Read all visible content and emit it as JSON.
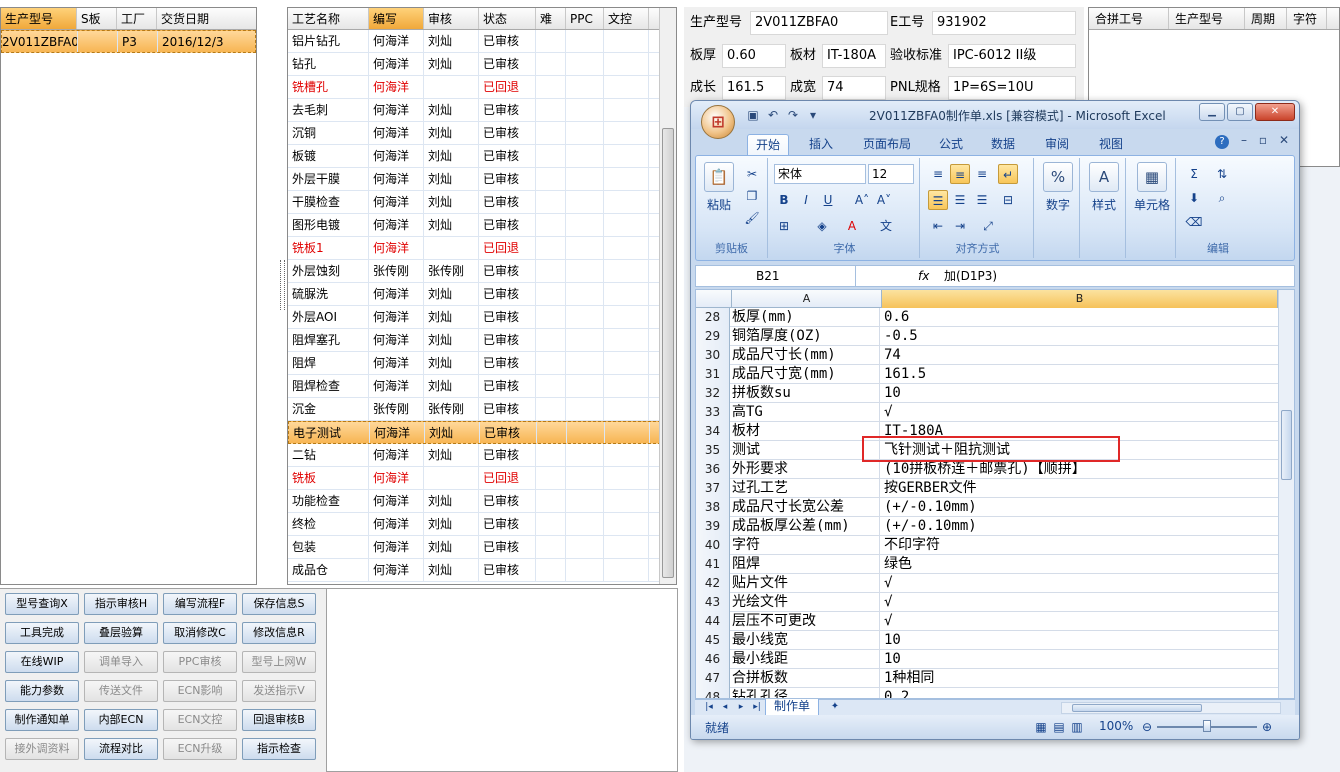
{
  "order_grid": {
    "columns": [
      "生产型号",
      "S板",
      "工厂",
      "交货日期"
    ],
    "rows": [
      {
        "model": "2V011ZBFA0",
        "s_board": "",
        "factory": "P3",
        "date": "2016/12/3"
      }
    ]
  },
  "process_grid": {
    "columns": [
      "工艺名称",
      "编写",
      "审核",
      "状态",
      "难",
      "PPC",
      "文控"
    ],
    "rows": [
      {
        "name": "铝片钻孔",
        "writer": "何海洋",
        "auditor": "刘灿",
        "status": "已审核",
        "red": false
      },
      {
        "name": "钻孔",
        "writer": "何海洋",
        "auditor": "刘灿",
        "status": "已审核",
        "red": false
      },
      {
        "name": "铣槽孔",
        "writer": "何海洋",
        "auditor": "",
        "status": "已回退",
        "red": true
      },
      {
        "name": "去毛刺",
        "writer": "何海洋",
        "auditor": "刘灿",
        "status": "已审核",
        "red": false
      },
      {
        "name": "沉铜",
        "writer": "何海洋",
        "auditor": "刘灿",
        "status": "已审核",
        "red": false
      },
      {
        "name": "板镀",
        "writer": "何海洋",
        "auditor": "刘灿",
        "status": "已审核",
        "red": false
      },
      {
        "name": "外层干膜",
        "writer": "何海洋",
        "auditor": "刘灿",
        "status": "已审核",
        "red": false
      },
      {
        "name": "干膜检查",
        "writer": "何海洋",
        "auditor": "刘灿",
        "status": "已审核",
        "red": false
      },
      {
        "name": "图形电镀",
        "writer": "何海洋",
        "auditor": "刘灿",
        "status": "已审核",
        "red": false
      },
      {
        "name": "铣板1",
        "writer": "何海洋",
        "auditor": "",
        "status": "已回退",
        "red": true
      },
      {
        "name": "外层蚀刻",
        "writer": "张传刚",
        "auditor": "张传刚",
        "status": "已审核",
        "red": false
      },
      {
        "name": "硫脲洗",
        "writer": "何海洋",
        "auditor": "刘灿",
        "status": "已审核",
        "red": false
      },
      {
        "name": "外层AOI",
        "writer": "何海洋",
        "auditor": "刘灿",
        "status": "已审核",
        "red": false
      },
      {
        "name": "阻焊塞孔",
        "writer": "何海洋",
        "auditor": "刘灿",
        "status": "已审核",
        "red": false
      },
      {
        "name": "阻焊",
        "writer": "何海洋",
        "auditor": "刘灿",
        "status": "已审核",
        "red": false
      },
      {
        "name": "阻焊检查",
        "writer": "何海洋",
        "auditor": "刘灿",
        "status": "已审核",
        "red": false
      },
      {
        "name": "沉金",
        "writer": "张传刚",
        "auditor": "张传刚",
        "status": "已审核",
        "red": false
      },
      {
        "name": "电子测试",
        "writer": "何海洋",
        "auditor": "刘灿",
        "status": "已审核",
        "red": false,
        "selected": true
      },
      {
        "name": "二钻",
        "writer": "何海洋",
        "auditor": "刘灿",
        "status": "已审核",
        "red": false
      },
      {
        "name": "铣板",
        "writer": "何海洋",
        "auditor": "",
        "status": "已回退",
        "red": true
      },
      {
        "name": "功能检查",
        "writer": "何海洋",
        "auditor": "刘灿",
        "status": "已审核",
        "red": false
      },
      {
        "name": "终检",
        "writer": "何海洋",
        "auditor": "刘灿",
        "status": "已审核",
        "red": false
      },
      {
        "name": "包装",
        "writer": "何海洋",
        "auditor": "刘灿",
        "status": "已审核",
        "red": false
      },
      {
        "name": "成品仓",
        "writer": "何海洋",
        "auditor": "刘灿",
        "status": "已审核",
        "red": false
      }
    ]
  },
  "buttons": [
    [
      {
        "label": "型号查询X",
        "disabled": false
      },
      {
        "label": "指示审核H",
        "disabled": false
      },
      {
        "label": "编写流程F",
        "disabled": false
      },
      {
        "label": "保存信息S",
        "disabled": false
      }
    ],
    [
      {
        "label": "工具完成",
        "disabled": false
      },
      {
        "label": "叠层验算",
        "disabled": false
      },
      {
        "label": "取消修改C",
        "disabled": false
      },
      {
        "label": "修改信息R",
        "disabled": false
      }
    ],
    [
      {
        "label": "在线WIP",
        "disabled": false
      },
      {
        "label": "调单导入",
        "disabled": true
      },
      {
        "label": "PPC审核",
        "disabled": true
      },
      {
        "label": "型号上网W",
        "disabled": true
      }
    ],
    [
      {
        "label": "能力参数",
        "disabled": false
      },
      {
        "label": "传送文件",
        "disabled": true
      },
      {
        "label": "ECN影响",
        "disabled": true
      },
      {
        "label": "发送指示V",
        "disabled": true
      }
    ],
    [
      {
        "label": "制作通知单",
        "disabled": false
      },
      {
        "label": "内部ECN",
        "disabled": false
      },
      {
        "label": "ECN文控",
        "disabled": true
      },
      {
        "label": "回退审核B",
        "disabled": false
      }
    ],
    [
      {
        "label": "接外调资料",
        "disabled": true
      },
      {
        "label": "流程对比",
        "disabled": false
      },
      {
        "label": "ECN升级",
        "disabled": true
      },
      {
        "label": "指示检查",
        "disabled": false
      }
    ]
  ],
  "info": {
    "model_label": "生产型号",
    "model_value": "2V011ZBFA0",
    "e_label": "E工号",
    "e_value": "931902",
    "thickness_label": "板厚",
    "thickness_value": "0.60",
    "material_label": "板材",
    "material_value": "IT-180A",
    "standard_label": "验收标准",
    "standard_value": "IPC-6012 II级",
    "length_label": "成长",
    "length_value": "161.5",
    "width_label": "成宽",
    "width_value": "74",
    "pnl_label": "PNL规格",
    "pnl_value": "1P=6S=10U"
  },
  "merge_grid": {
    "columns": [
      "合拼工号",
      "生产型号",
      "周期",
      "字符"
    ]
  },
  "excel": {
    "title": "2V011ZBFA0制作单.xls  [兼容模式] - Microsoft Excel",
    "office_button": "⊞",
    "tabs": [
      "开始",
      "插入",
      "页面布局",
      "公式",
      "数据",
      "审阅",
      "视图"
    ],
    "ribbon": {
      "paste_label": "粘贴",
      "clipboard_group": "剪贴板",
      "font_name": "宋体",
      "font_size": "12",
      "font_group": "字体",
      "align_group": "对齐方式",
      "number_label": "数字",
      "style_label": "样式",
      "cell_label": "单元格",
      "edit_group": "编辑"
    },
    "name_box": "B21",
    "fx": "fx",
    "formula": "加(D1P3)",
    "col_a": "A",
    "col_b": "B",
    "rows": [
      {
        "n": "28",
        "a": "板厚(mm)",
        "b": "0.6"
      },
      {
        "n": "29",
        "a": "铜箔厚度(OZ)",
        "b": "-0.5"
      },
      {
        "n": "30",
        "a": "成品尺寸长(mm)",
        "b": "74"
      },
      {
        "n": "31",
        "a": "成品尺寸宽(mm)",
        "b": "161.5"
      },
      {
        "n": "32",
        "a": "拼板数su",
        "b": "10"
      },
      {
        "n": "33",
        "a": "高TG",
        "b": "√"
      },
      {
        "n": "34",
        "a": "板材",
        "b": "IT-180A"
      },
      {
        "n": "35",
        "a": "测试",
        "b": "飞针测试＋阻抗测试"
      },
      {
        "n": "36",
        "a": "外形要求",
        "b": "(10拼板桥连＋邮票孔)【顺拼】"
      },
      {
        "n": "37",
        "a": "过孔工艺",
        "b": "按GERBER文件"
      },
      {
        "n": "38",
        "a": "成品尺寸长宽公差",
        "b": "(+/-0.10mm)"
      },
      {
        "n": "39",
        "a": "成品板厚公差(mm)",
        "b": "(+/-0.10mm)"
      },
      {
        "n": "40",
        "a": "字符",
        "b": "不印字符"
      },
      {
        "n": "41",
        "a": "阻焊",
        "b": "绿色"
      },
      {
        "n": "42",
        "a": "贴片文件",
        "b": "√"
      },
      {
        "n": "43",
        "a": "光绘文件",
        "b": "√"
      },
      {
        "n": "44",
        "a": "层压不可更改",
        "b": "√"
      },
      {
        "n": "45",
        "a": "最小线宽",
        "b": "10"
      },
      {
        "n": "46",
        "a": "最小线距",
        "b": "10"
      },
      {
        "n": "47",
        "a": "合拼板数",
        "b": "1种相同"
      },
      {
        "n": "48",
        "a": "钻孔孔径",
        "b": "0.2"
      }
    ],
    "sheet_tab": "制作单",
    "status": "就绪",
    "zoom": "100%"
  }
}
